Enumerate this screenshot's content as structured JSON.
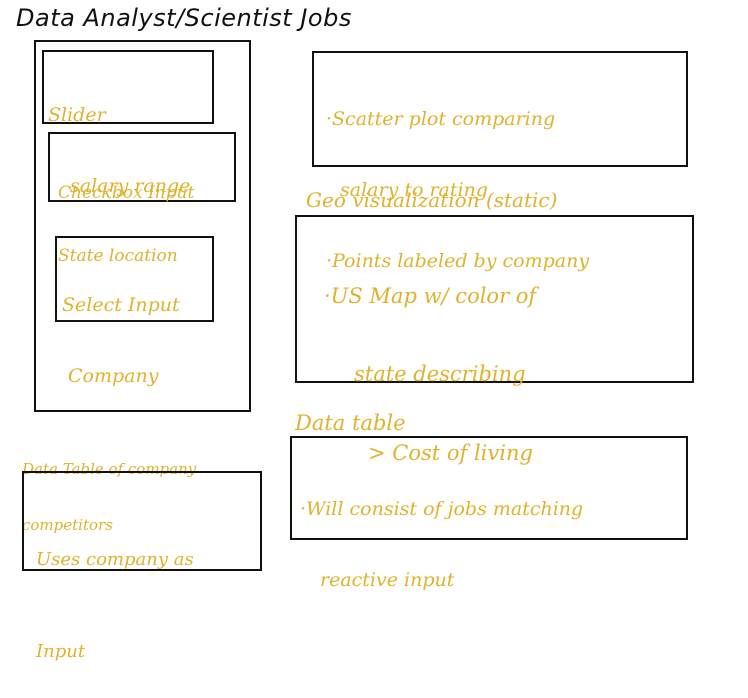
{
  "title": "Data Analyst/Scientist Jobs",
  "sidebar": {
    "slider": {
      "line1": "Slider",
      "line2": "salary range"
    },
    "checkbox": {
      "line1": "Checkbox Input",
      "line2": "State location"
    },
    "select": {
      "line1": "Select Input",
      "line2": "Company"
    }
  },
  "competitors": {
    "heading_line1": "Data Table of company",
    "heading_line2": "competitors",
    "body_line1": "Uses company as",
    "body_line2": "Input"
  },
  "scatter": {
    "line1": "·Scatter plot comparing",
    "line2": "salary to rating",
    "line3": "·Points labeled by company"
  },
  "geo": {
    "heading": "Geo visualization (static)",
    "line1": "·US Map w/ color of",
    "line2": "state describing",
    "line3": "> Cost of living"
  },
  "datatable": {
    "heading": "Data table",
    "line1": "·Will consist of jobs matching",
    "line2": "reactive input"
  },
  "colors": {
    "ink": "#111111",
    "annotation": "#e0b22c"
  }
}
